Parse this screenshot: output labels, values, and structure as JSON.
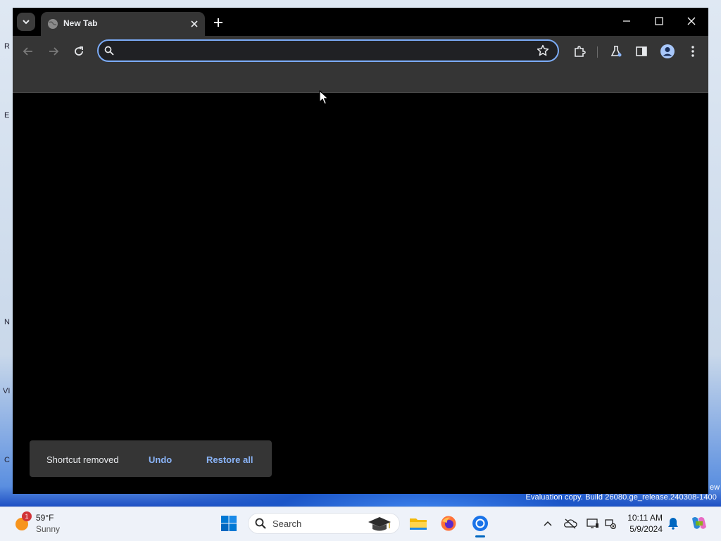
{
  "desktop": {
    "fragments": [
      "R",
      "E",
      "N",
      "VI",
      "C"
    ],
    "watermark": "Evaluation copy. Build 26080.ge_release.240308-1400",
    "watermark_fragment": "ew"
  },
  "browser": {
    "tab": {
      "title": "New Tab",
      "favicon": "globe-icon"
    },
    "window_controls": [
      "minimize-icon",
      "maximize-icon",
      "close-icon"
    ],
    "omnibox": {
      "value": "",
      "placeholder": ""
    },
    "toolbar_icons": [
      "back-icon",
      "forward-icon",
      "reload-icon",
      "extensions-icon",
      "labs-flask-icon",
      "side-panel-icon",
      "profile-icon",
      "menu-kebab-icon"
    ],
    "toast": {
      "message": "Shortcut removed",
      "undo_label": "Undo",
      "restore_label": "Restore all"
    },
    "colors": {
      "frame": "#000000",
      "toolbar": "#353535",
      "omnibox_border": "#7cacf8",
      "link": "#8ab4f8"
    }
  },
  "taskbar": {
    "weather": {
      "badge": "1",
      "temp": "59°F",
      "condition": "Sunny"
    },
    "search_label": "Search",
    "apps": [
      "windows-start-icon",
      "file-explorer-icon",
      "firefox-icon",
      "chrome-icon"
    ],
    "tray_icons": [
      "chevron-up-icon",
      "onedrive-off-icon",
      "display-icon",
      "network-icon",
      "bell-icon",
      "copilot-icon"
    ],
    "clock": {
      "time": "10:11 AM",
      "date": "5/9/2024"
    }
  }
}
